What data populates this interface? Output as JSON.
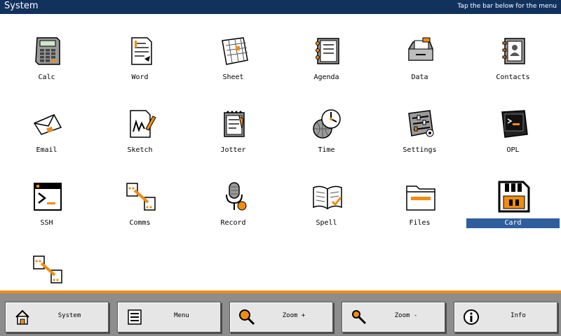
{
  "titlebar": {
    "title": "System",
    "hint": "Tap the bar below for the menu"
  },
  "apps": [
    {
      "label": "Calc",
      "icon": "calculator-icon"
    },
    {
      "label": "Word",
      "icon": "word-document-icon"
    },
    {
      "label": "Sheet",
      "icon": "spreadsheet-icon"
    },
    {
      "label": "Agenda",
      "icon": "agenda-book-icon"
    },
    {
      "label": "Data",
      "icon": "card-file-icon"
    },
    {
      "label": "Contacts",
      "icon": "contacts-book-icon"
    },
    {
      "label": "Email",
      "icon": "envelope-icon"
    },
    {
      "label": "Sketch",
      "icon": "sketch-pencil-icon"
    },
    {
      "label": "Jotter",
      "icon": "notepad-icon"
    },
    {
      "label": "Time",
      "icon": "clock-globe-icon"
    },
    {
      "label": "Settings",
      "icon": "settings-sliders-icon"
    },
    {
      "label": "OPL",
      "icon": "opl-terminal-icon"
    },
    {
      "label": "SSH",
      "icon": "terminal-prompt-icon"
    },
    {
      "label": "Comms",
      "icon": "comms-link-icon"
    },
    {
      "label": "Record",
      "icon": "microphone-icon"
    },
    {
      "label": "Spell",
      "icon": "open-book-icon"
    },
    {
      "label": "Files",
      "icon": "folder-icon"
    },
    {
      "label": "Card",
      "icon": "memory-card-icon"
    },
    {
      "label": "",
      "icon": "comms-link-icon"
    }
  ],
  "selected_app": "Card",
  "dock": [
    {
      "label": "System",
      "icon": "home-icon"
    },
    {
      "label": "Menu",
      "icon": "menu-list-icon"
    },
    {
      "label": "Zoom +",
      "icon": "zoom-in-icon"
    },
    {
      "label": "Zoom -",
      "icon": "zoom-out-icon"
    },
    {
      "label": "Info",
      "icon": "info-icon"
    }
  ],
  "colors": {
    "titlebar": "#12325e",
    "accent": "#f08c10",
    "selection": "#2f5e9d",
    "dock": "#8d8d8d"
  }
}
